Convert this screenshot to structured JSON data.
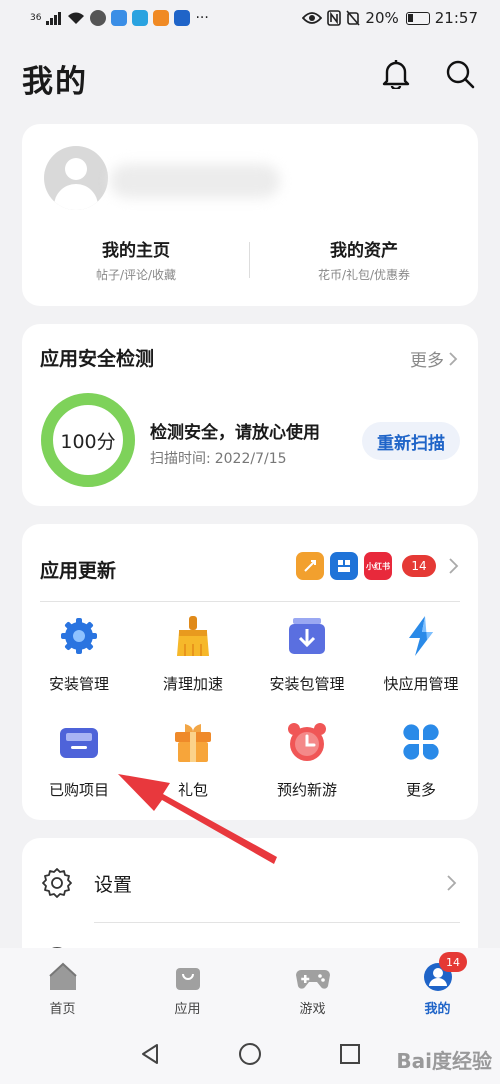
{
  "status_bar": {
    "signal": "36 ",
    "battery": "20%",
    "time": "21:57"
  },
  "header": {
    "title": "我的"
  },
  "profile": {
    "my_home": {
      "title": "我的主页",
      "subtitle": "帖子/评论/收藏"
    },
    "my_assets": {
      "title": "我的资产",
      "subtitle": "花币/礼包/优惠券"
    }
  },
  "security": {
    "title": "应用安全检测",
    "more": "更多",
    "score": "100分",
    "score_fraction": 1.0,
    "status": "检测安全，请放心使用",
    "scan_time_label": "扫描时间:",
    "scan_time": "2022/7/15",
    "rescan": "重新扫描"
  },
  "updates": {
    "title": "应用更新",
    "badge": "14",
    "apps": [
      {
        "name": "rocket-app",
        "color": "#f2a02e",
        "text": ""
      },
      {
        "name": "blue-app",
        "color": "#1f73d8",
        "text": ""
      },
      {
        "name": "xiaohongshu-app",
        "color": "#e8293b",
        "text": "小红书"
      }
    ],
    "grid": [
      {
        "label": "安装管理",
        "icon": "gear-icon"
      },
      {
        "label": "清理加速",
        "icon": "broom-icon"
      },
      {
        "label": "安装包管理",
        "icon": "package-icon"
      },
      {
        "label": "快应用管理",
        "icon": "lightning-icon"
      },
      {
        "label": "已购项目",
        "icon": "inbox-icon"
      },
      {
        "label": "礼包",
        "icon": "gift-icon"
      },
      {
        "label": "预约新游",
        "icon": "alarm-clock-icon"
      },
      {
        "label": "更多",
        "icon": "clover-icon"
      }
    ]
  },
  "settings": {
    "label": "设置"
  },
  "bottom_nav": {
    "items": [
      {
        "label": "首页"
      },
      {
        "label": "应用"
      },
      {
        "label": "游戏"
      },
      {
        "label": "我的",
        "badge": "14"
      }
    ]
  },
  "watermark": "Bai度经验",
  "colors": {
    "accent": "#1f64c8",
    "ring_green": "#7ed25a",
    "badge_red": "#e53935",
    "arrow_red": "#e8383d"
  }
}
